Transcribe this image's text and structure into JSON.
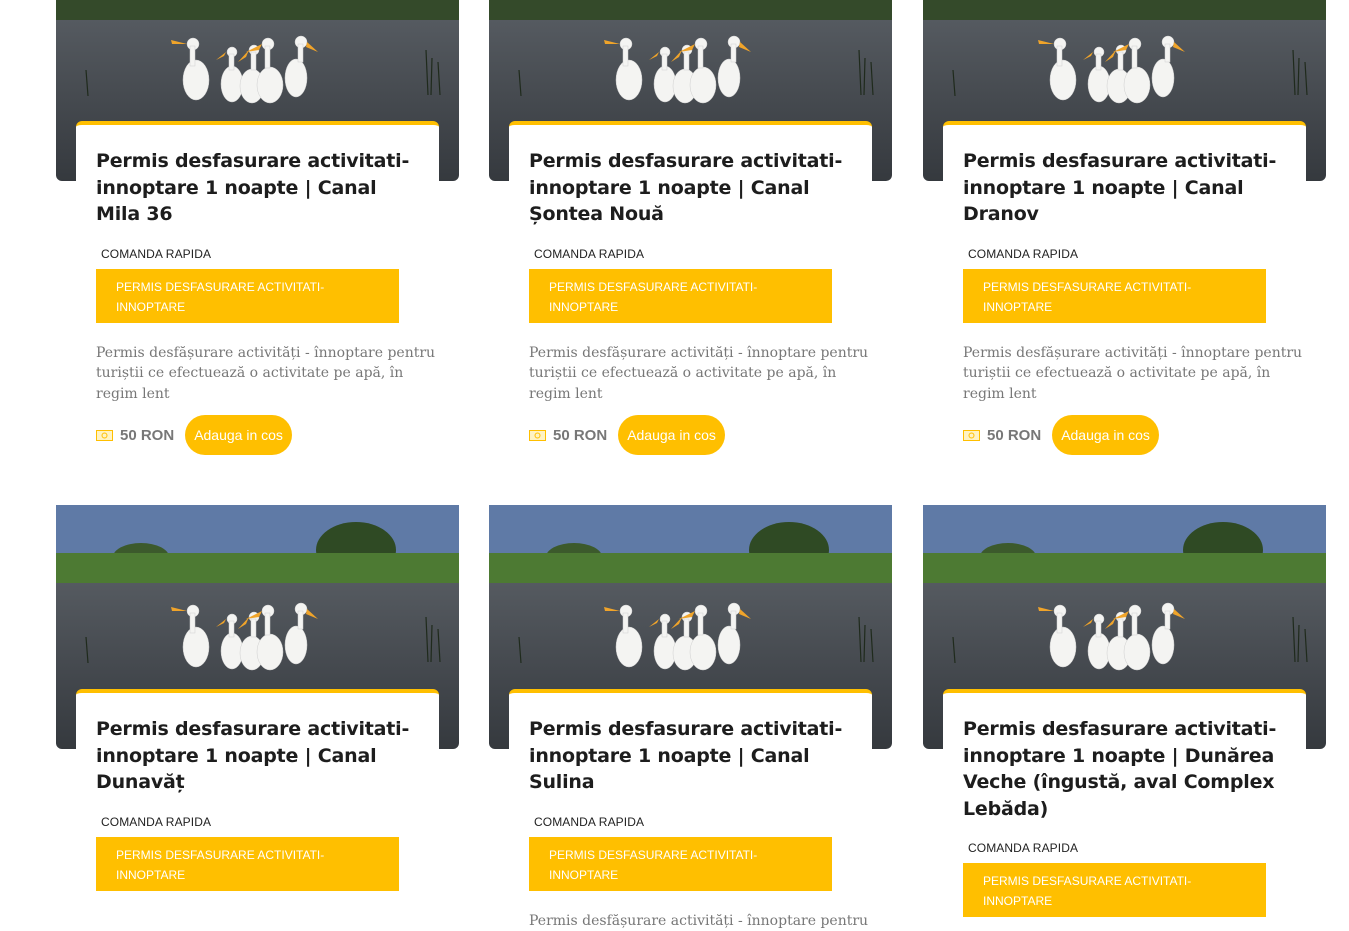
{
  "colors": {
    "accent": "#ffbf00",
    "title": "#1d1d1d",
    "text": "#777777"
  },
  "cards": [
    {
      "title": "Permis desfasurare activitati-innoptare 1 noapte | Canal Mila 36",
      "quick": "COMANDA RAPIDA",
      "category": "PERMIS DESFASURARE ACTIVITATI-INNOPTARE",
      "description": "Permis desfășurare activități - înnoptare pentru turiștii ce efectuează o activitate pe apă, în regim lent",
      "price": "50 RON",
      "add_label": "Adauga in cos",
      "icon": "money-icon"
    },
    {
      "title": "Permis desfasurare activitati-innoptare 1 noapte | Canal Șontea Nouă",
      "quick": "COMANDA RAPIDA",
      "category": "PERMIS DESFASURARE ACTIVITATI-INNOPTARE",
      "description": "Permis desfășurare activități - înnoptare pentru turiștii ce efectuează o activitate pe apă, în regim lent",
      "price": "50 RON",
      "add_label": "Adauga in cos",
      "icon": "money-icon"
    },
    {
      "title": "Permis desfasurare activitati-innoptare 1 noapte | Canal Dranov",
      "quick": "COMANDA RAPIDA",
      "category": "PERMIS DESFASURARE ACTIVITATI-INNOPTARE",
      "description": "Permis desfășurare activități - înnoptare pentru turiștii ce efectuează o activitate pe apă, în regim lent",
      "price": "50 RON",
      "add_label": "Adauga in cos",
      "icon": "money-icon"
    },
    {
      "title": "Permis desfasurare activitati-innoptare 1 noapte | Canal Dunavăț",
      "quick": "COMANDA RAPIDA",
      "category": "PERMIS DESFASURARE ACTIVITATI-INNOPTARE"
    },
    {
      "title": "Permis desfasurare activitati-innoptare 1 noapte | Canal Sulina",
      "quick": "COMANDA RAPIDA",
      "category": "PERMIS DESFASURARE ACTIVITATI-INNOPTARE",
      "description": "Permis desfășurare activități - înnoptare pentru"
    },
    {
      "title": "Permis desfasurare activitati-innoptare 1 noapte | Dunărea Veche (îngustă, aval Complex Lebăda)",
      "quick": "COMANDA RAPIDA",
      "category": "PERMIS DESFASURARE ACTIVITATI-INNOPTARE"
    }
  ]
}
